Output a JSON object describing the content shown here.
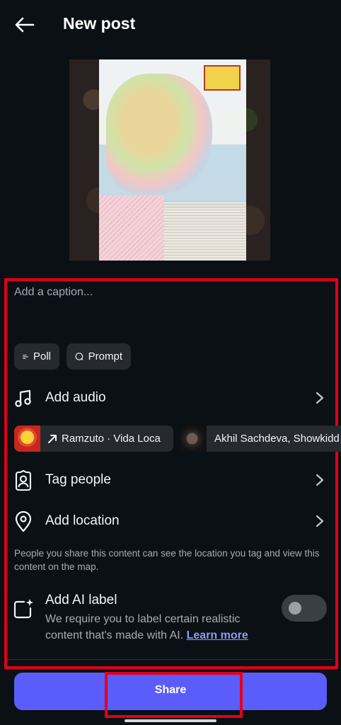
{
  "header": {
    "title": "New post",
    "back_icon": "arrow-left-icon"
  },
  "caption": {
    "placeholder": "Add a caption..."
  },
  "chips": [
    {
      "label": "Poll",
      "icon": "poll-icon"
    },
    {
      "label": "Prompt",
      "icon": "prompt-icon"
    }
  ],
  "audio": {
    "label": "Add audio",
    "icon": "music-note-icon"
  },
  "suggested_songs": [
    {
      "label": "Ramzuto · Vida Loca",
      "icon": "trending-arrow-icon"
    },
    {
      "label": "Akhil Sachdeva, Showkidd"
    }
  ],
  "tag_people": {
    "label": "Tag people",
    "icon": "tag-person-icon"
  },
  "location": {
    "label": "Add location",
    "icon": "location-pin-icon",
    "note": "People you share this content can see the location you tag and view this content on the map."
  },
  "ai_label": {
    "label": "Add AI label",
    "description": "We require you to label certain realistic content that's made with AI.",
    "learn_more": "Learn more",
    "toggle_on": false
  },
  "share": {
    "label": "Share"
  },
  "colors": {
    "accent": "#5b5dfa",
    "highlight": "#e1001b",
    "background": "#0b1014"
  }
}
